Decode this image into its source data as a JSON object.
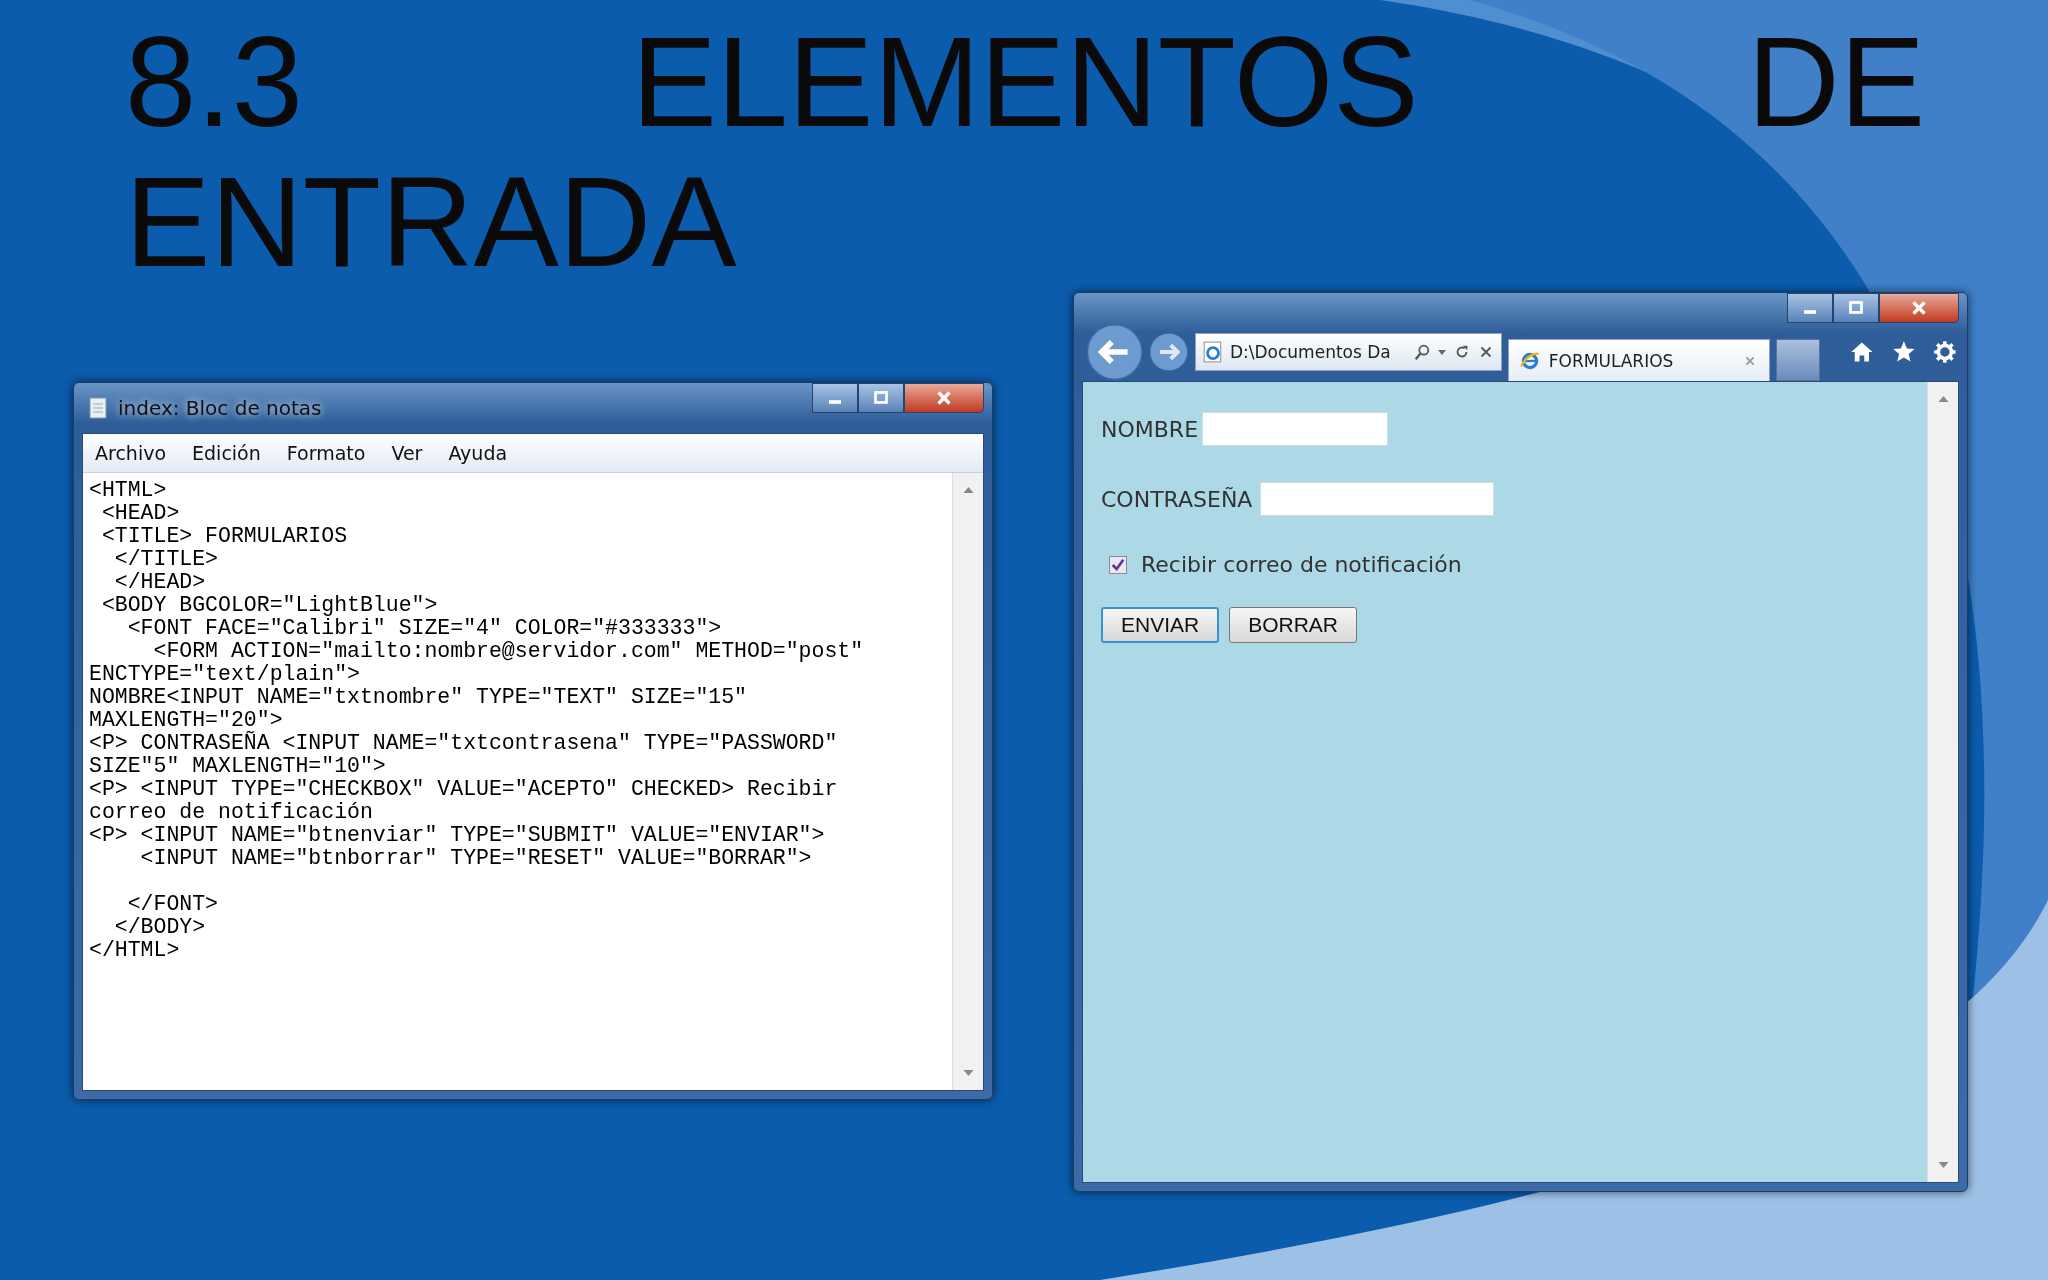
{
  "slide": {
    "title": "8.3 ELEMENTOS DE ENTRADA"
  },
  "notepad": {
    "title": "index: Bloc de notas",
    "menu": [
      "Archivo",
      "Edición",
      "Formato",
      "Ver",
      "Ayuda"
    ],
    "blocks": [
      [
        "<HTML>",
        " <HEAD>",
        " <TITLE> FORMULARIOS",
        "  </TITLE>",
        "  </HEAD>",
        " <BODY BGCOLOR=\"LightBlue\">",
        "   <FONT FACE=\"Calibri\" SIZE=\"4\" COLOR=\"#333333\">",
        "     <FORM ACTION=\"mailto:nombre@servidor.com\" METHOD=\"post\"",
        "ENCTYPE=\"text/plain\">",
        "NOMBRE<INPUT NAME=\"txtnombre\" TYPE=\"TEXT\" SIZE=\"15\"",
        "MAXLENGTH=\"20\">",
        "<P> CONTRASEÑA <INPUT NAME=\"txtcontrasena\" TYPE=\"PASSWORD\"",
        "SIZE\"5\" MAXLENGTH=\"10\">",
        "<P> <INPUT TYPE=\"CHECKBOX\" VALUE=\"ACEPTO\" CHECKED> Recibir",
        "correo de notificación",
        "<P> <INPUT NAME=\"btnenviar\" TYPE=\"SUBMIT\" VALUE=\"ENVIAR\">",
        "    <INPUT NAME=\"btnborrar\" TYPE=\"RESET\" VALUE=\"BORRAR\">"
      ],
      [
        "   </FONT>",
        "  </BODY>",
        "</HTML>"
      ]
    ]
  },
  "browser": {
    "address": "D:\\Documentos Da",
    "tab": "FORMULARIOS",
    "fields": [
      {
        "label": "NOMBRE",
        "kind": "text"
      },
      {
        "label": "CONTRASEÑA",
        "kind": "password"
      }
    ],
    "checkbox": {
      "label": "Recibir correo de notificación",
      "checked": true
    },
    "buttons": [
      {
        "label": "ENVIAR",
        "focused": true
      },
      {
        "label": "BORRAR",
        "focused": false
      }
    ]
  }
}
